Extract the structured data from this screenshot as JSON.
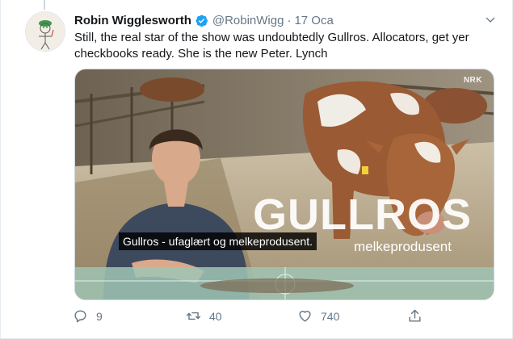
{
  "tweet": {
    "author_name": "Robin Wigglesworth",
    "handle": "@RobinWigg",
    "separator": "·",
    "date": "17 Oca",
    "text": "Still, the real star of the show was undoubtedly Gullros. Allocators, get yer checkbooks ready. She is the new Peter. Lynch",
    "verified": true
  },
  "media": {
    "watermark": "NRK",
    "title_overlay": "GULLROS",
    "subtitle_overlay": "melkeprodusent",
    "caption": "Gullros - ufaglært og melkeprodusent."
  },
  "actions": {
    "replies": "9",
    "retweets": "40",
    "likes": "740"
  },
  "icons": {
    "reply": "reply-icon",
    "retweet": "retweet-icon",
    "like": "heart-icon",
    "share": "share-icon",
    "more": "chevron-down-icon",
    "verified": "verified-badge-icon"
  },
  "colors": {
    "verified_blue": "#1da1f2",
    "secondary_text": "#657786"
  }
}
